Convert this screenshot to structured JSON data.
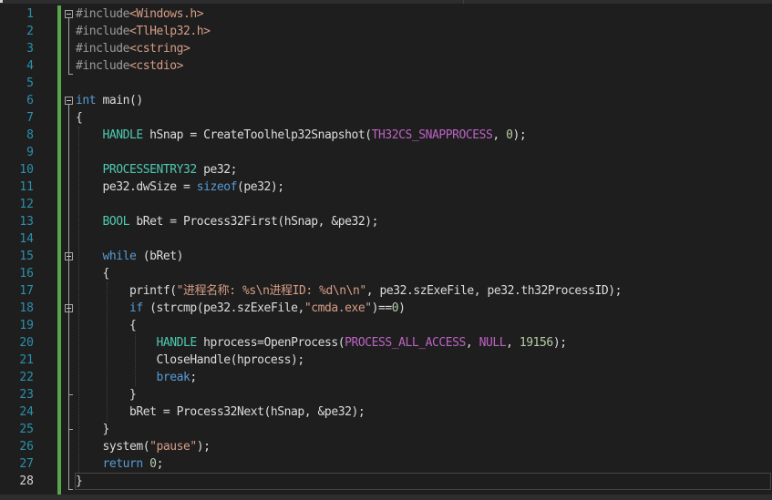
{
  "editor": {
    "current_line": 28,
    "lines": [
      {
        "num": "1",
        "tokens": [
          {
            "t": "#include",
            "c": "pp"
          },
          {
            "t": "<Windows.h>",
            "c": "str"
          }
        ]
      },
      {
        "num": "2",
        "tokens": [
          {
            "t": "#include",
            "c": "pp"
          },
          {
            "t": "<TlHelp32.h>",
            "c": "str"
          }
        ]
      },
      {
        "num": "3",
        "tokens": [
          {
            "t": "#include",
            "c": "pp"
          },
          {
            "t": "<cstring>",
            "c": "str"
          }
        ]
      },
      {
        "num": "4",
        "tokens": [
          {
            "t": "#include",
            "c": "pp"
          },
          {
            "t": "<cstdio>",
            "c": "str"
          }
        ]
      },
      {
        "num": "5",
        "tokens": []
      },
      {
        "num": "6",
        "tokens": [
          {
            "t": "int",
            "c": "kw"
          },
          {
            "t": " main()",
            "c": ""
          }
        ]
      },
      {
        "num": "7",
        "tokens": [
          {
            "t": "{",
            "c": ""
          }
        ]
      },
      {
        "num": "8",
        "tokens": [
          {
            "t": "    ",
            "c": ""
          },
          {
            "t": "HANDLE",
            "c": "type"
          },
          {
            "t": " hSnap = CreateToolhelp32Snapshot(",
            "c": ""
          },
          {
            "t": "TH32CS_SNAPPROCESS",
            "c": "macro"
          },
          {
            "t": ", ",
            "c": ""
          },
          {
            "t": "0",
            "c": "num"
          },
          {
            "t": ");",
            "c": ""
          }
        ]
      },
      {
        "num": "9",
        "tokens": []
      },
      {
        "num": "10",
        "tokens": [
          {
            "t": "    ",
            "c": ""
          },
          {
            "t": "PROCESSENTRY32",
            "c": "type"
          },
          {
            "t": " pe32;",
            "c": ""
          }
        ]
      },
      {
        "num": "11",
        "tokens": [
          {
            "t": "    pe32.dwSize = ",
            "c": ""
          },
          {
            "t": "sizeof",
            "c": "kw"
          },
          {
            "t": "(pe32);",
            "c": ""
          }
        ]
      },
      {
        "num": "12",
        "tokens": []
      },
      {
        "num": "13",
        "tokens": [
          {
            "t": "    ",
            "c": ""
          },
          {
            "t": "BOOL",
            "c": "type"
          },
          {
            "t": " bRet = Process32First(hSnap, &pe32);",
            "c": ""
          }
        ]
      },
      {
        "num": "14",
        "tokens": []
      },
      {
        "num": "15",
        "tokens": [
          {
            "t": "    ",
            "c": ""
          },
          {
            "t": "while",
            "c": "kw"
          },
          {
            "t": " (bRet)",
            "c": ""
          }
        ]
      },
      {
        "num": "16",
        "tokens": [
          {
            "t": "    {",
            "c": ""
          }
        ]
      },
      {
        "num": "17",
        "tokens": [
          {
            "t": "        printf(",
            "c": ""
          },
          {
            "t": "\"进程名称: %s\\n进程ID: %d\\n\\n\"",
            "c": "str"
          },
          {
            "t": ", pe32.szExeFile, pe32.th32ProcessID);",
            "c": ""
          }
        ]
      },
      {
        "num": "18",
        "tokens": [
          {
            "t": "        ",
            "c": ""
          },
          {
            "t": "if",
            "c": "kw"
          },
          {
            "t": " (strcmp(pe32.szExeFile,",
            "c": ""
          },
          {
            "t": "\"cmda.exe\"",
            "c": "str"
          },
          {
            "t": ")==",
            "c": ""
          },
          {
            "t": "0",
            "c": "num"
          },
          {
            "t": ")",
            "c": ""
          }
        ]
      },
      {
        "num": "19",
        "tokens": [
          {
            "t": "        {",
            "c": ""
          }
        ]
      },
      {
        "num": "20",
        "tokens": [
          {
            "t": "            ",
            "c": ""
          },
          {
            "t": "HANDLE",
            "c": "type"
          },
          {
            "t": " hprocess=OpenProcess(",
            "c": ""
          },
          {
            "t": "PROCESS_ALL_ACCESS",
            "c": "macro"
          },
          {
            "t": ", ",
            "c": ""
          },
          {
            "t": "NULL",
            "c": "macro"
          },
          {
            "t": ", ",
            "c": ""
          },
          {
            "t": "19156",
            "c": "num"
          },
          {
            "t": ");",
            "c": ""
          }
        ]
      },
      {
        "num": "21",
        "tokens": [
          {
            "t": "            CloseHandle(hprocess);",
            "c": ""
          }
        ]
      },
      {
        "num": "22",
        "tokens": [
          {
            "t": "            ",
            "c": ""
          },
          {
            "t": "break",
            "c": "kw"
          },
          {
            "t": ";",
            "c": ""
          }
        ]
      },
      {
        "num": "23",
        "tokens": [
          {
            "t": "        }",
            "c": ""
          }
        ]
      },
      {
        "num": "24",
        "tokens": [
          {
            "t": "        bRet = Process32Next(hSnap, &pe32);",
            "c": ""
          }
        ]
      },
      {
        "num": "25",
        "tokens": [
          {
            "t": "    }",
            "c": ""
          }
        ]
      },
      {
        "num": "26",
        "tokens": [
          {
            "t": "    system(",
            "c": ""
          },
          {
            "t": "\"pause\"",
            "c": "str"
          },
          {
            "t": ");",
            "c": ""
          }
        ]
      },
      {
        "num": "27",
        "tokens": [
          {
            "t": "    ",
            "c": ""
          },
          {
            "t": "return",
            "c": "kw"
          },
          {
            "t": " ",
            "c": ""
          },
          {
            "t": "0",
            "c": "num"
          },
          {
            "t": ";",
            "c": ""
          }
        ]
      },
      {
        "num": "28",
        "tokens": [
          {
            "t": "}",
            "c": ""
          }
        ]
      }
    ]
  }
}
